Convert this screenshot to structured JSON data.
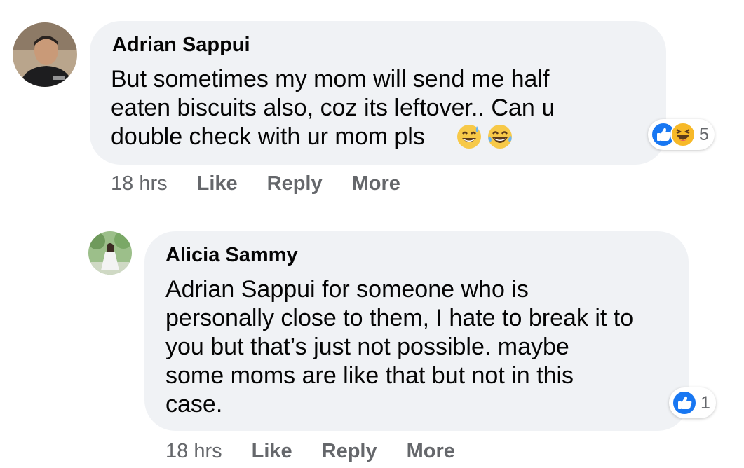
{
  "comments": [
    {
      "author": "Adrian Sappui",
      "text": "But sometimes my mom will send me half\neaten biscuits also, coz its leftover.. Can u\ndouble check with ur mom pls",
      "emojis": [
        "sweat-smile-emoji",
        "joy-emoji"
      ],
      "reactions": {
        "icons": [
          "like-icon",
          "haha-icon"
        ],
        "count": "5"
      },
      "time": "18 hrs",
      "actions": {
        "like": "Like",
        "reply": "Reply",
        "more": "More"
      }
    },
    {
      "author": "Alicia Sammy",
      "text": "Adrian Sappui for someone who is\npersonally close to them, I hate to break it to\nyou but that’s just not possible. maybe\nsome moms are like that but not in this\ncase.",
      "reactions": {
        "icons": [
          "like-icon"
        ],
        "count": "1"
      },
      "time": "18 hrs",
      "actions": {
        "like": "Like",
        "reply": "Reply",
        "more": "More"
      }
    }
  ],
  "colors": {
    "bubble": "#f0f2f5",
    "meta": "#65676b",
    "like_blue": "#1877f2",
    "haha_yellow": "#f7b928"
  }
}
